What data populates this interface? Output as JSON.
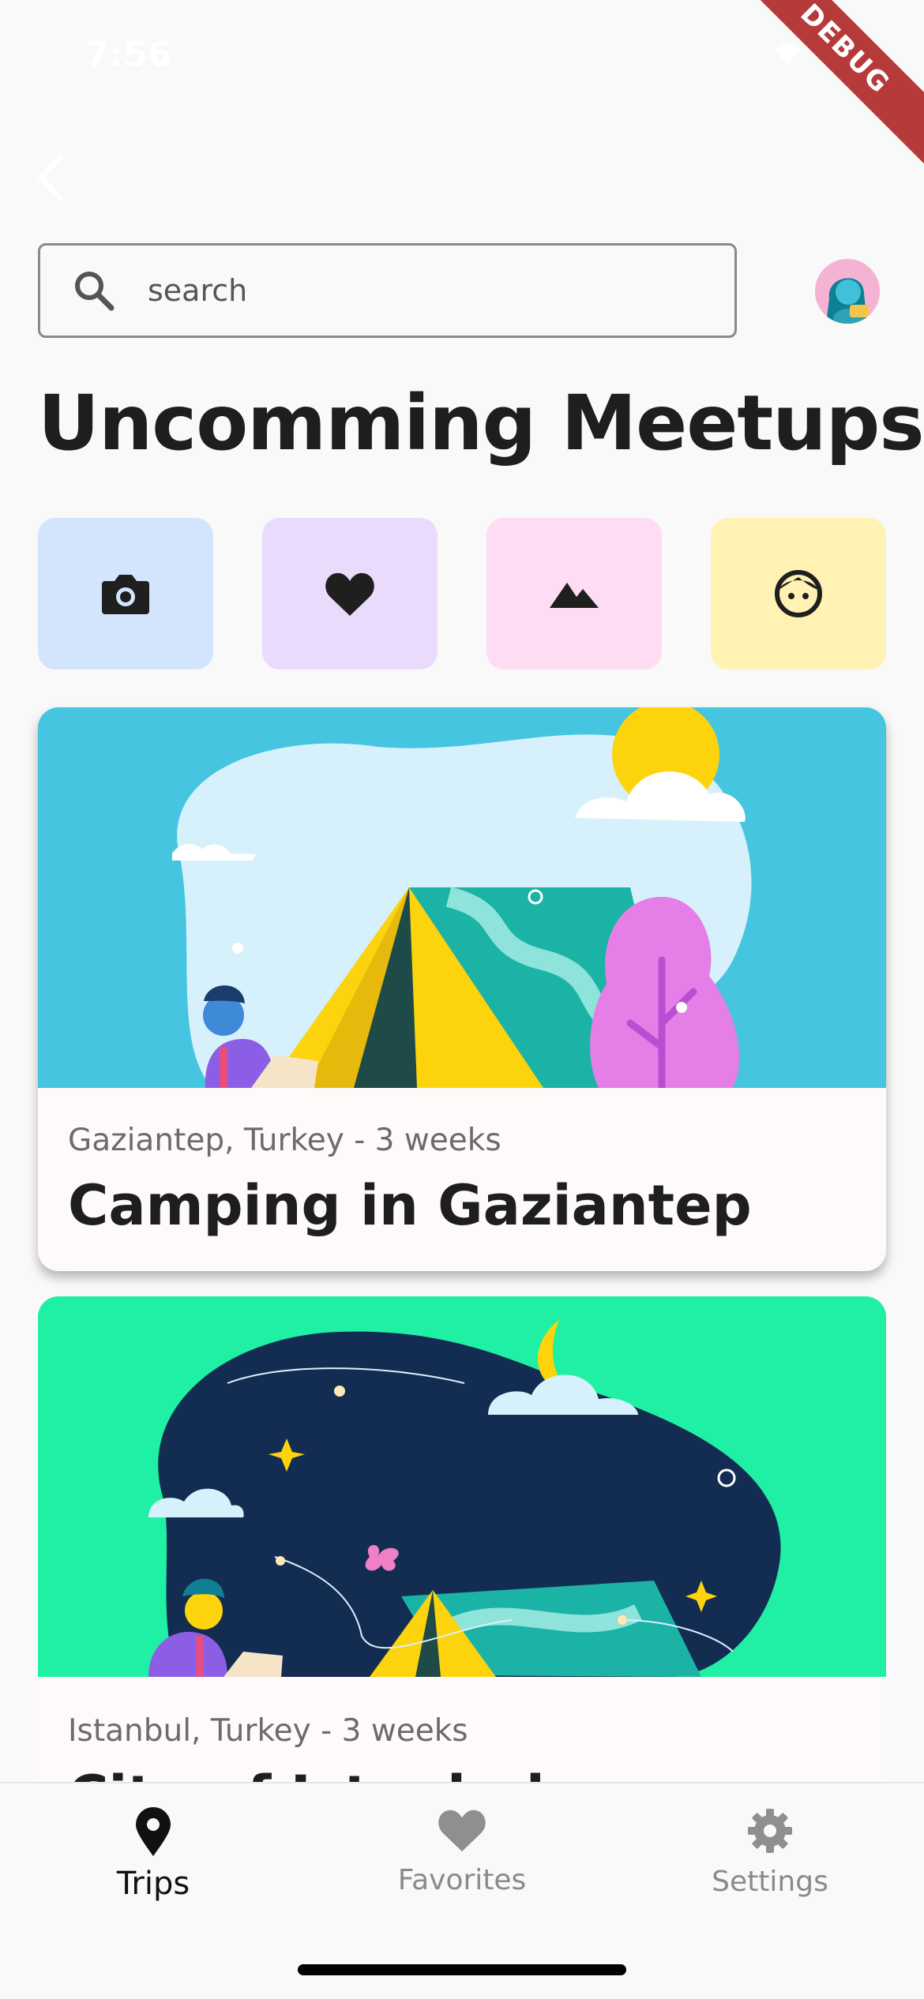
{
  "status_bar": {
    "time": "7:56"
  },
  "debug_banner": {
    "label": "DEBUG"
  },
  "search": {
    "placeholder": "search",
    "value": ""
  },
  "page": {
    "title": "Uncomming Meetups"
  },
  "categories": [
    {
      "icon": "camera-icon",
      "bg": "#d3e4fd"
    },
    {
      "icon": "heart-icon",
      "bg": "#eadbfc"
    },
    {
      "icon": "mountains-icon",
      "bg": "#fedcf3"
    },
    {
      "icon": "face-icon",
      "bg": "#fff2b3"
    }
  ],
  "trips": [
    {
      "meta": "Gaziantep, Turkey - 3 weeks",
      "title": "Camping in Gaziantep",
      "bg": "#45c5df"
    },
    {
      "meta": "Istanbul, Turkey - 3 weeks",
      "title": "City of Istanbul",
      "bg": "#1ff0a4"
    }
  ],
  "nav": {
    "items": [
      {
        "label": "Trips",
        "icon": "location-pin-icon",
        "active": true
      },
      {
        "label": "Favorites",
        "icon": "heart-icon",
        "active": false
      },
      {
        "label": "Settings",
        "icon": "gear-icon",
        "active": false
      }
    ]
  }
}
